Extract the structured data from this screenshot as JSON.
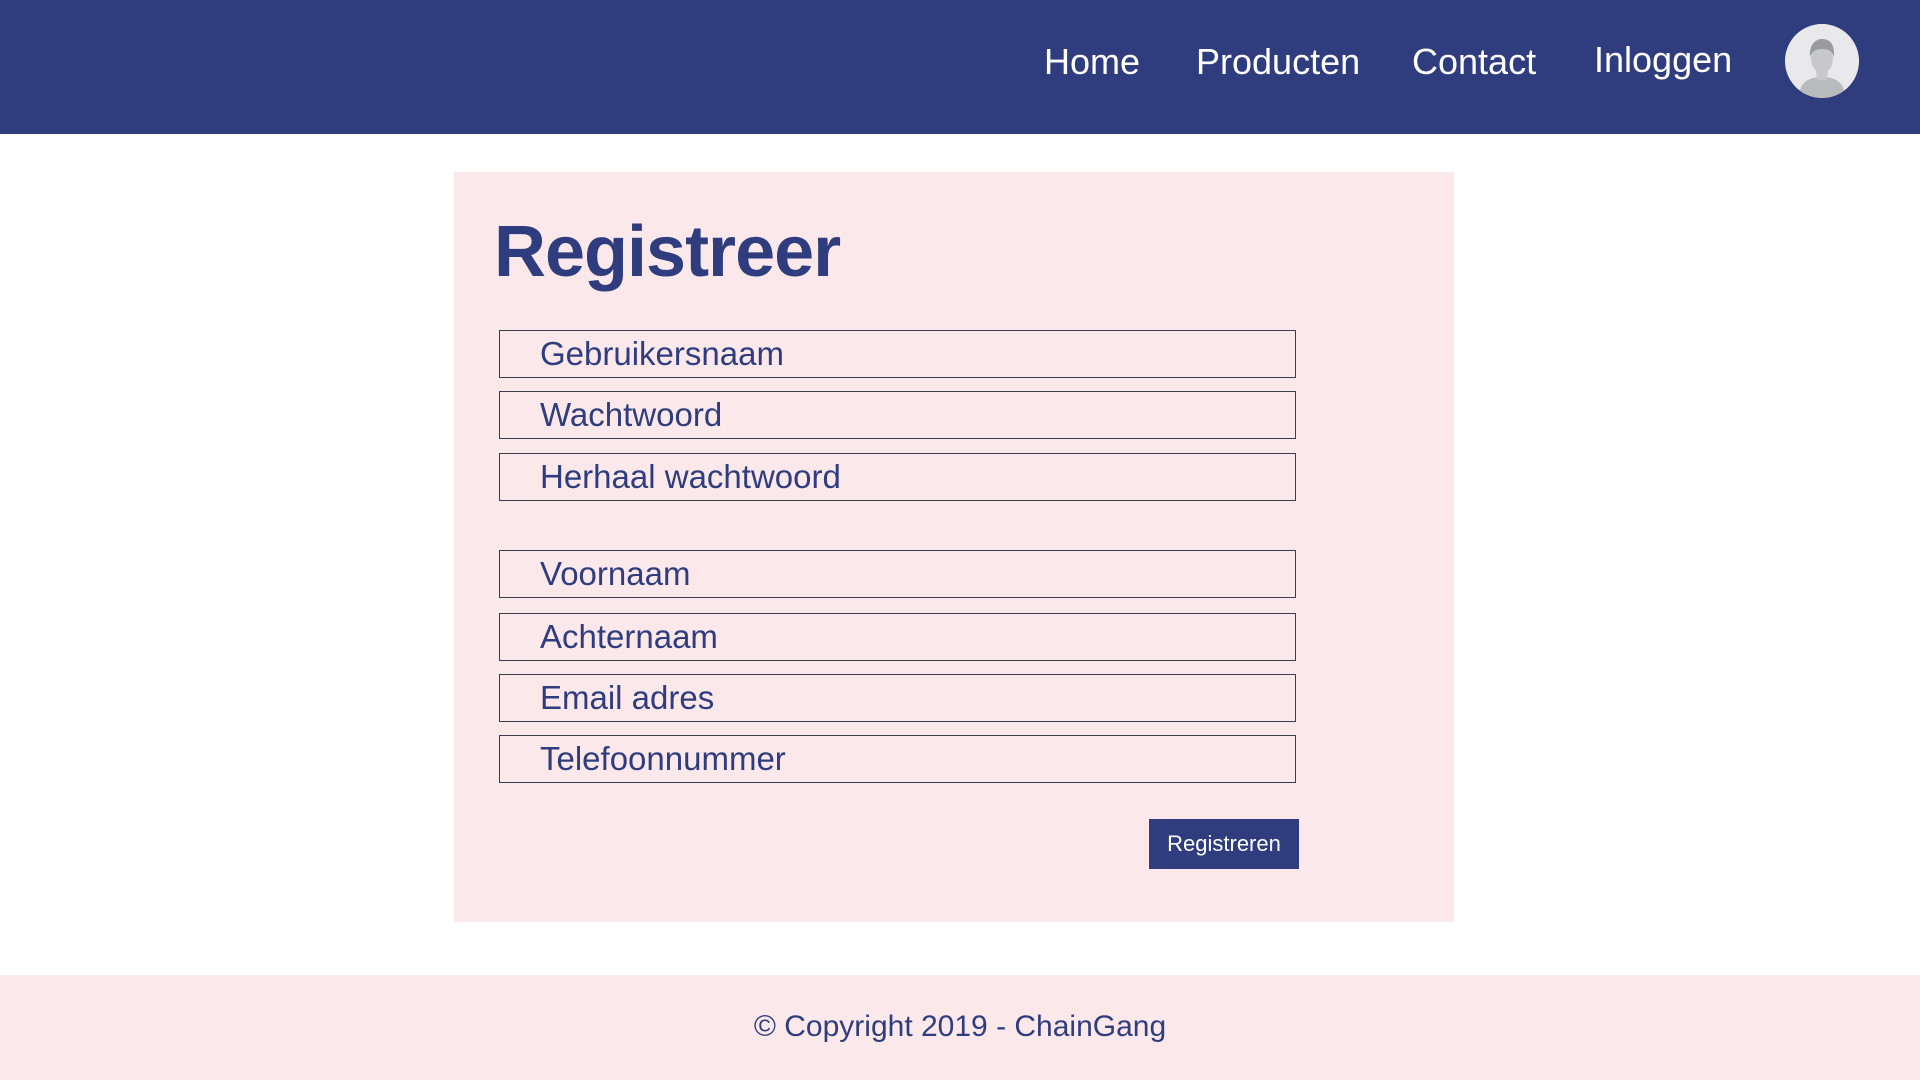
{
  "header": {
    "nav": {
      "home": "Home",
      "products": "Producten",
      "contact": "Contact",
      "login": "Inloggen"
    },
    "avatar_icon": "user-avatar-icon"
  },
  "form": {
    "title": "Registreer",
    "fields": {
      "username": "Gebruikersnaam",
      "password": "Wachtwoord",
      "repeat_password": "Herhaal wachtwoord",
      "first_name": "Voornaam",
      "last_name": "Achternaam",
      "email": "Email adres",
      "phone": "Telefoonnummer"
    },
    "submit_label": "Registreren"
  },
  "footer": {
    "text": "© Copyright 2019 - ChainGang"
  },
  "colors": {
    "brand": "#2f3d7e",
    "card_background": "#fae8ea",
    "field_border": "#3b3d4a"
  }
}
